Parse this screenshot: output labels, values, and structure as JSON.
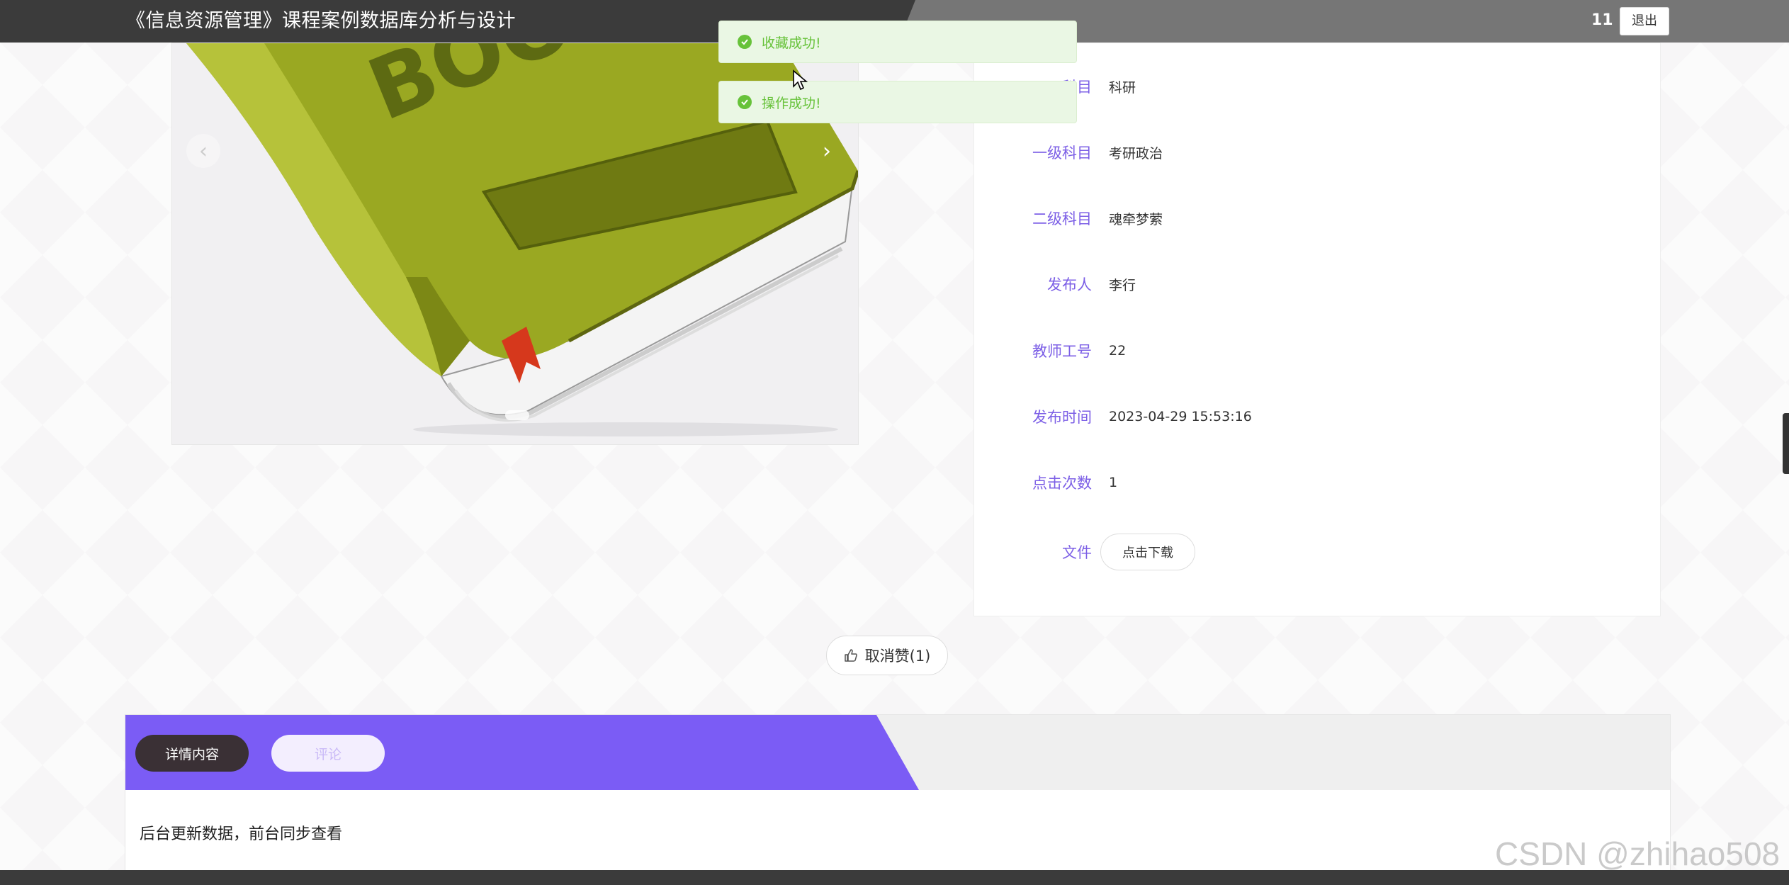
{
  "header": {
    "title": "《信息资源管理》课程案例数据库分析与设计",
    "user_name": "11",
    "logout_label": "退出"
  },
  "toasts": [
    {
      "message": "收藏成功!"
    },
    {
      "message": "操作成功!"
    }
  ],
  "carousel": {
    "prev_icon": "‹",
    "next_icon": "›",
    "book_text": "BOO"
  },
  "info": {
    "rows": [
      {
        "label": "科目",
        "value": "科研"
      },
      {
        "label": "一级科目",
        "value": "考研政治"
      },
      {
        "label": "二级科目",
        "value": "魂牵梦萦"
      },
      {
        "label": "发布人",
        "value": "李行"
      },
      {
        "label": "教师工号",
        "value": "22"
      },
      {
        "label": "发布时间",
        "value": "2023-04-29 15:53:16"
      },
      {
        "label": "点击次数",
        "value": "1"
      }
    ],
    "file_label": "文件",
    "download_label": "点击下载"
  },
  "like": {
    "label": "取消赞(1)"
  },
  "tabs": {
    "items": [
      {
        "label": "详情内容"
      },
      {
        "label": "评论"
      }
    ],
    "content": "后台更新数据，前台同步查看"
  },
  "watermark": "CSDN @zhihao508",
  "colors": {
    "accent": "#7b5cf5",
    "success": "#67c23a",
    "header": "#3b3b3b"
  }
}
